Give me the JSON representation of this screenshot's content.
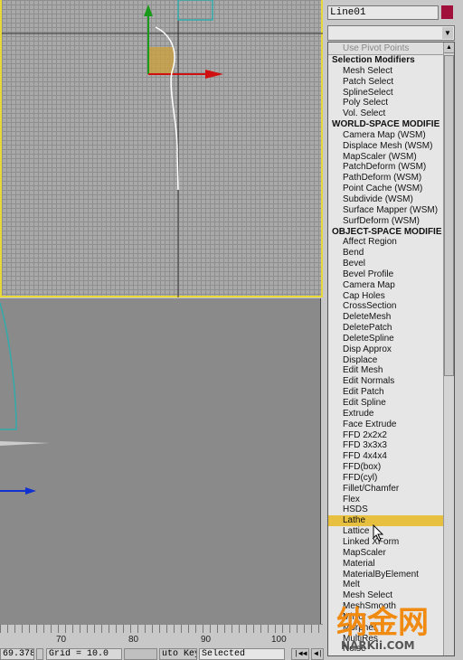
{
  "object_name": "Line01",
  "object_color": "#a0103a",
  "modifier_list": {
    "pivot_option": "Use Pivot Points",
    "selected": "Lathe",
    "groups": [
      {
        "header": "Selection Modifiers",
        "items": [
          "Mesh Select",
          "Patch Select",
          "SplineSelect",
          "Poly Select",
          "Vol. Select"
        ]
      },
      {
        "header": "WORLD-SPACE MODIFIE",
        "items": [
          "Camera Map (WSM)",
          "Displace Mesh (WSM)",
          "MapScaler (WSM)",
          "PatchDeform (WSM)",
          "PathDeform (WSM)",
          "Point Cache (WSM)",
          "Subdivide (WSM)",
          "Surface Mapper (WSM)",
          "SurfDeform (WSM)"
        ]
      },
      {
        "header": "OBJECT-SPACE MODIFIE",
        "items": [
          "Affect Region",
          "Bend",
          "Bevel",
          "Bevel Profile",
          "Camera Map",
          "Cap Holes",
          "CrossSection",
          "DeleteMesh",
          "DeletePatch",
          "DeleteSpline",
          "Disp Approx",
          "Displace",
          "Edit Mesh",
          "Edit Normals",
          "Edit Patch",
          "Edit Spline",
          "Extrude",
          "Face Extrude",
          "FFD 2x2x2",
          "FFD 3x3x3",
          "FFD 4x4x4",
          "FFD(box)",
          "FFD(cyl)",
          "Fillet/Chamfer",
          "Flex",
          "HSDS",
          "Lathe",
          "Lattice",
          "Linked XForm",
          "MapScaler",
          "Material",
          "MaterialByElement",
          "Melt",
          "Mesh Select",
          "MeshSmooth",
          "Mirror",
          "Morpher",
          "MultiRes",
          "Noise"
        ]
      }
    ]
  },
  "timeline": {
    "ticks": [
      "70",
      "80",
      "90",
      "100"
    ]
  },
  "status": {
    "coord": "69.378",
    "grid": "Grid = 10.0",
    "autokey": "uto Key",
    "key_filter": "Selected"
  },
  "watermark": "纳金网 NARKii.COM"
}
